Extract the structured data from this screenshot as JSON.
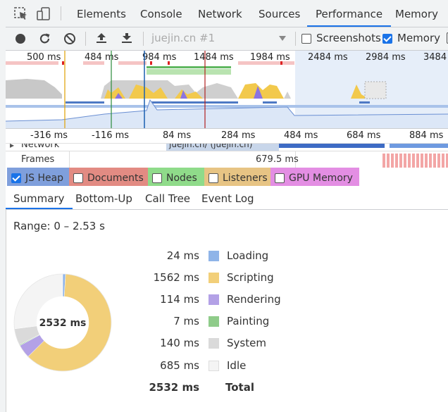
{
  "tabs": [
    "Elements",
    "Console",
    "Network",
    "Sources",
    "Performance",
    "Memory"
  ],
  "active_tab": "Performance",
  "toolbar": {
    "profile_select": "juejin.cn #1",
    "screenshots_label": "Screenshots",
    "screenshots_checked": false,
    "memory_label": "Memory",
    "memory_checked": true
  },
  "overview": {
    "ticks": [
      "500 ms",
      "484 ms",
      "984 ms",
      "1484 ms",
      "1984 ms",
      "2484 ms",
      "2984 ms",
      "3484"
    ]
  },
  "ruler": {
    "ticks": [
      "-316 ms",
      "-116 ms",
      "84 ms",
      "284 ms",
      "484 ms",
      "684 ms",
      "884 ms"
    ]
  },
  "tracks": {
    "network_label": "Network",
    "network_text": "juejin.cn/ (juejin.cn)",
    "frames_label": "Frames",
    "frame_time": "679.5 ms"
  },
  "counters": [
    {
      "label": "JS Heap",
      "checked": true,
      "color": "#5c7fd0"
    },
    {
      "label": "Documents",
      "checked": false,
      "color": "#d9746e"
    },
    {
      "label": "Nodes",
      "checked": false,
      "color": "#6fcf6f"
    },
    {
      "label": "Listeners",
      "checked": false,
      "color": "#d8b66a"
    },
    {
      "label": "GPU Memory",
      "checked": false,
      "color": "#d975d9"
    }
  ],
  "bottom_tabs": [
    "Summary",
    "Bottom-Up",
    "Call Tree",
    "Event Log"
  ],
  "active_bottom_tab": "Summary",
  "summary": {
    "range": "Range: 0 – 2.53 s",
    "center_label": "2532 ms",
    "rows": [
      {
        "value": "24 ms",
        "label": "Loading",
        "color": "#8fb4e8",
        "ms": 24
      },
      {
        "value": "1562 ms",
        "label": "Scripting",
        "color": "#f2cf79",
        "ms": 1562
      },
      {
        "value": "114 ms",
        "label": "Rendering",
        "color": "#b3a1e6",
        "ms": 114
      },
      {
        "value": "7 ms",
        "label": "Painting",
        "color": "#8fcc8a",
        "ms": 7
      },
      {
        "value": "140 ms",
        "label": "System",
        "color": "#dadada",
        "ms": 140
      },
      {
        "value": "685 ms",
        "label": "Idle",
        "color": "#f4f4f4",
        "ms": 685
      }
    ],
    "total_value": "2532 ms",
    "total_label": "Total"
  }
}
